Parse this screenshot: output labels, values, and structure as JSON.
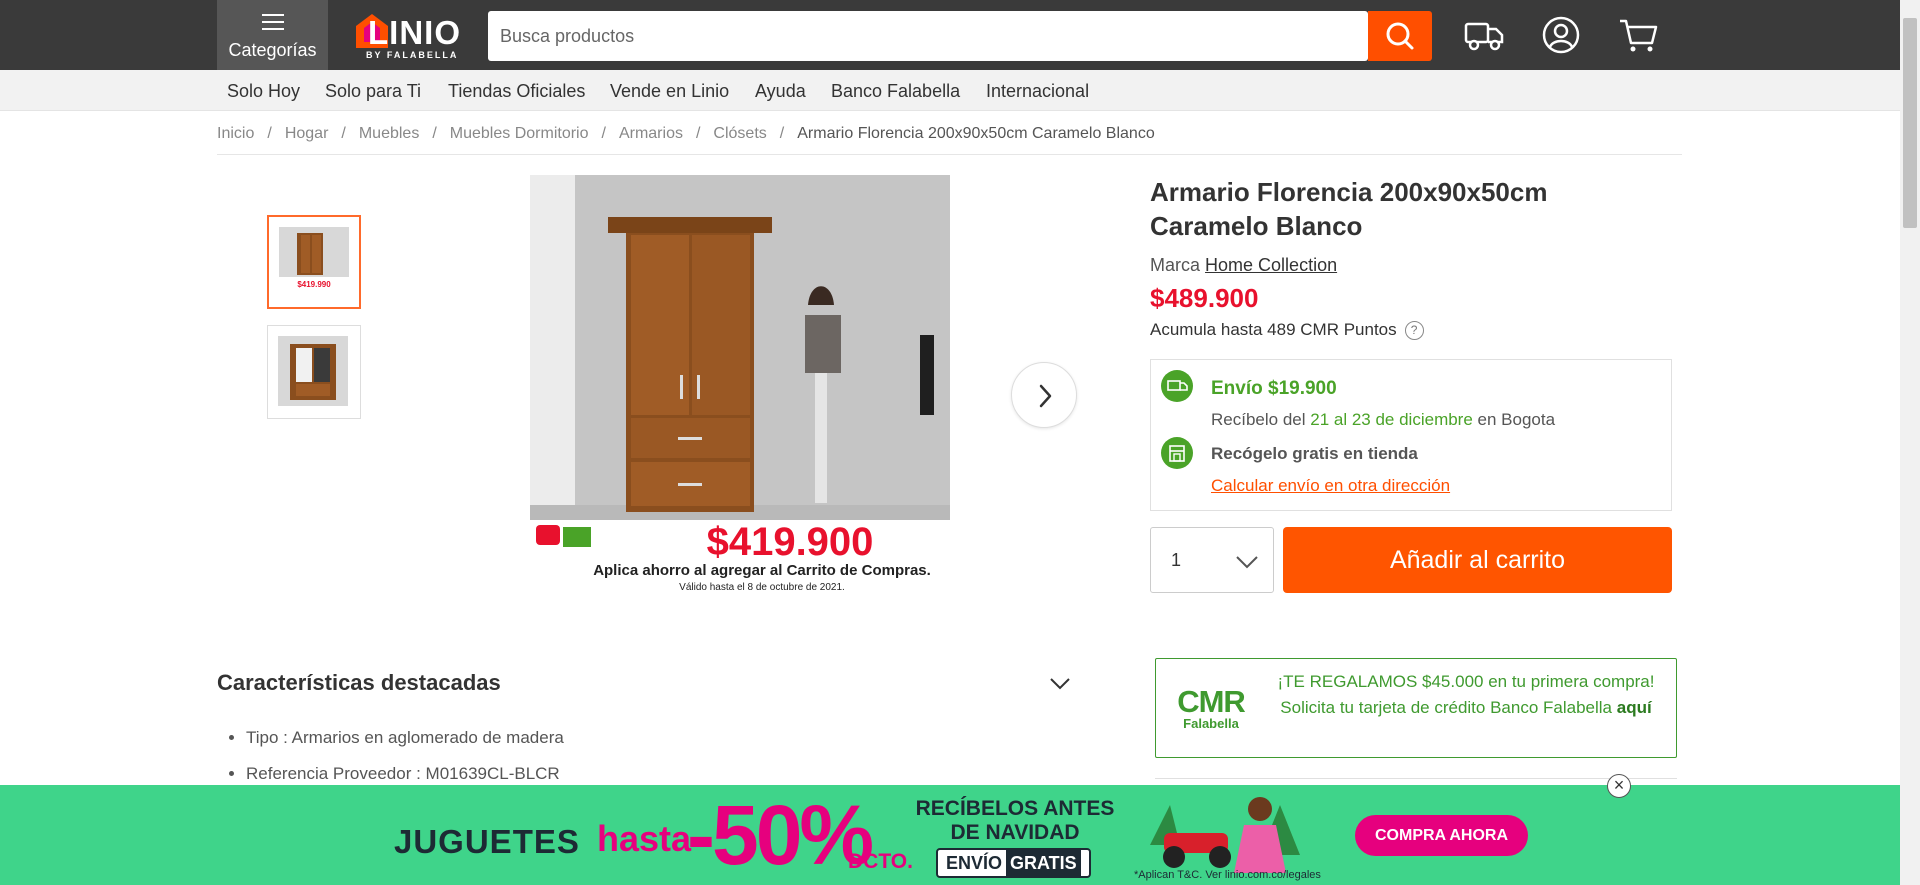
{
  "header": {
    "categories_label": "Categorías",
    "logo_text": "LINIO",
    "logo_sub": "BY FALABELLA",
    "search_placeholder": "Busca productos"
  },
  "nav": {
    "items": [
      "Solo Hoy",
      "Solo para Ti",
      "Tiendas Oficiales",
      "Vende en Linio",
      "Ayuda",
      "Banco Falabella",
      "Internacional"
    ]
  },
  "breadcrumb": [
    "Inicio",
    "Hogar",
    "Muebles",
    "Muebles Dormitorio",
    "Armarios",
    "Clósets",
    "Armario Florencia 200x90x50cm Caramelo Blanco"
  ],
  "gallery": {
    "promo_price": "$419.900",
    "promo_line": "Aplica ahorro al agregar al Carrito de Compras.",
    "promo_valid": "Válido hasta el 8 de octubre de 2021.",
    "thumb_price": "$419.990"
  },
  "product": {
    "title": "Armario Florencia 200x90x50cm Caramelo Blanco",
    "brand_label": "Marca",
    "brand": "Home Collection",
    "price": "$489.900",
    "points": "Acumula hasta 489 CMR Puntos",
    "help": "?"
  },
  "shipping": {
    "title": "Envío $19.900",
    "receive_prefix": "Recíbelo del",
    "receive_dates": "21 al 23 de diciembre",
    "receive_suffix": "en Bogota",
    "pickup": "Recógelo gratis en tienda",
    "calc_link": "Calcular envío en otra dirección"
  },
  "cart": {
    "qty": "1",
    "add_label": "Añadir al carrito"
  },
  "cmr": {
    "logo_big": "CMR",
    "logo_small": "Falabella",
    "promo": "¡TE REGALAMOS $45.000 en tu primera compra! Solicita tu tarjeta de crédito Banco Falabella",
    "promo_link": "aquí"
  },
  "features": {
    "title": "Características destacadas",
    "items": [
      "Tipo : Armarios en aglomerado de madera",
      "Referencia Proveedor : M01639CL-BLCR"
    ]
  },
  "banner": {
    "jugetes": "JUGUETES",
    "hasta": "hasta",
    "pct": "-50%",
    "dcto": "DCTO.",
    "recibelos": "RECÍBELOS ANTES DE NAVIDAD",
    "envio": "ENVÍO",
    "gratis": "GRATIS",
    "legal": "*Aplican T&C. Ver linio.com.co/legales",
    "cta": "COMPRA AHORA",
    "close": "×"
  },
  "colors": {
    "brand_orange": "#ff5500",
    "price_red": "#e8112d",
    "ship_green": "#4aa328",
    "banner_green": "#3fd48a",
    "banner_pink": "#e6007e"
  }
}
